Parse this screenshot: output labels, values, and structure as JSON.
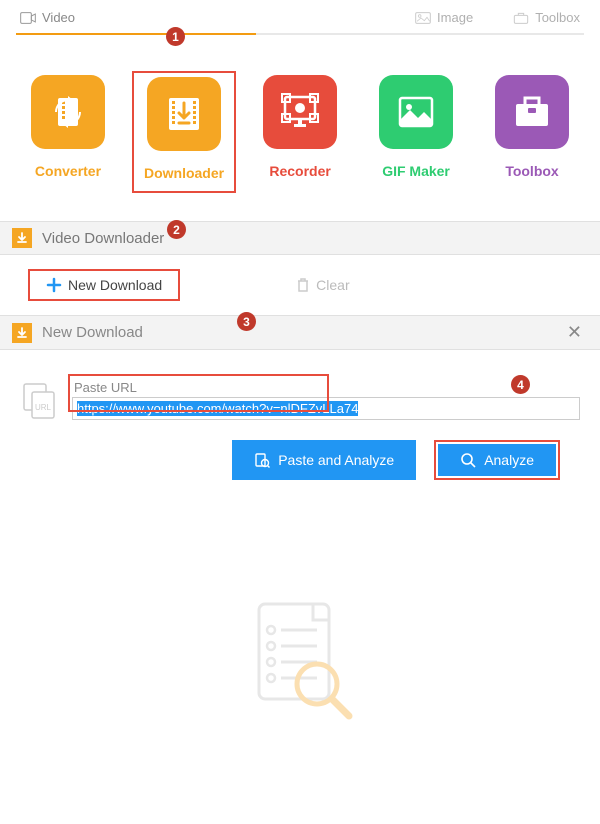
{
  "top_tabs": {
    "video": "Video",
    "image": "Image",
    "toolbox": "Toolbox"
  },
  "tools": {
    "converter": "Converter",
    "downloader": "Downloader",
    "recorder": "Recorder",
    "gifmaker": "GIF Maker",
    "toolbox": "Toolbox"
  },
  "section_title": "Video Downloader",
  "actions": {
    "new_download": "New Download",
    "clear": "Clear"
  },
  "dialog": {
    "title": "New Download",
    "url_label": "Paste URL",
    "url_value": "https://www.youtube.com/watch?v=nlDFZvLLa74",
    "paste_analyze": "Paste and Analyze",
    "analyze": "Analyze"
  },
  "badges": {
    "b1": "1",
    "b2": "2",
    "b3": "3",
    "b4": "4"
  }
}
